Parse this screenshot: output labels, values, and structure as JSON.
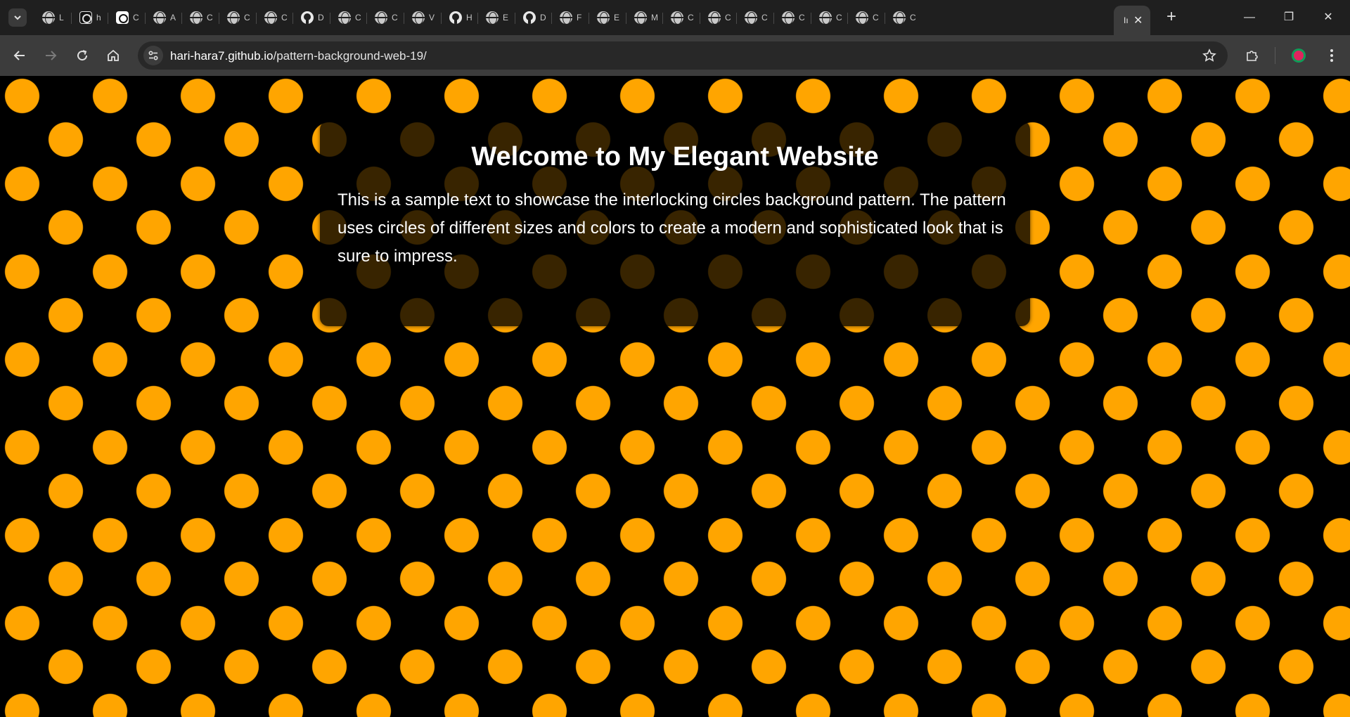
{
  "browser": {
    "tabs": [
      {
        "icon": "globe-icon",
        "title": "L"
      },
      {
        "icon": "chatgpt-icon",
        "title": "h"
      },
      {
        "icon": "chatgpt-icon",
        "title": "C"
      },
      {
        "icon": "globe-icon",
        "title": "A"
      },
      {
        "icon": "globe-icon",
        "title": "C"
      },
      {
        "icon": "globe-icon",
        "title": "C"
      },
      {
        "icon": "globe-icon",
        "title": "C"
      },
      {
        "icon": "github-icon",
        "title": "D"
      },
      {
        "icon": "globe-icon",
        "title": "C"
      },
      {
        "icon": "globe-icon",
        "title": "C"
      },
      {
        "icon": "globe-icon",
        "title": "V"
      },
      {
        "icon": "github-icon",
        "title": "H"
      },
      {
        "icon": "globe-icon",
        "title": "E"
      },
      {
        "icon": "github-icon",
        "title": "D"
      },
      {
        "icon": "globe-icon",
        "title": "F"
      },
      {
        "icon": "globe-icon",
        "title": "E"
      },
      {
        "icon": "globe-icon",
        "title": "M"
      },
      {
        "icon": "globe-icon",
        "title": "C"
      },
      {
        "icon": "globe-icon",
        "title": "C"
      },
      {
        "icon": "globe-icon",
        "title": "C"
      },
      {
        "icon": "globe-icon",
        "title": "C"
      },
      {
        "icon": "globe-icon",
        "title": "C"
      },
      {
        "icon": "globe-icon",
        "title": "C"
      },
      {
        "icon": "globe-icon",
        "title": "C"
      }
    ],
    "active_tab": {
      "title": "Iı",
      "close": "✕"
    },
    "new_tab": "+",
    "window_controls": {
      "minimize": "—",
      "restore": "❐",
      "close": "✕"
    },
    "url_host": "hari-hara7.github.io",
    "url_path": "/pattern-background-web-19/",
    "profile_color": "#e0245e"
  },
  "page": {
    "heading": "Welcome to My Elegant Website",
    "paragraph": "This is a sample text to showcase the interlocking circles background pattern. The pattern uses circles of different sizes and colors to create a modern and sophisticated look that is sure to impress.",
    "pattern_colors": {
      "circle": "#ffa500",
      "background": "#000000"
    }
  }
}
